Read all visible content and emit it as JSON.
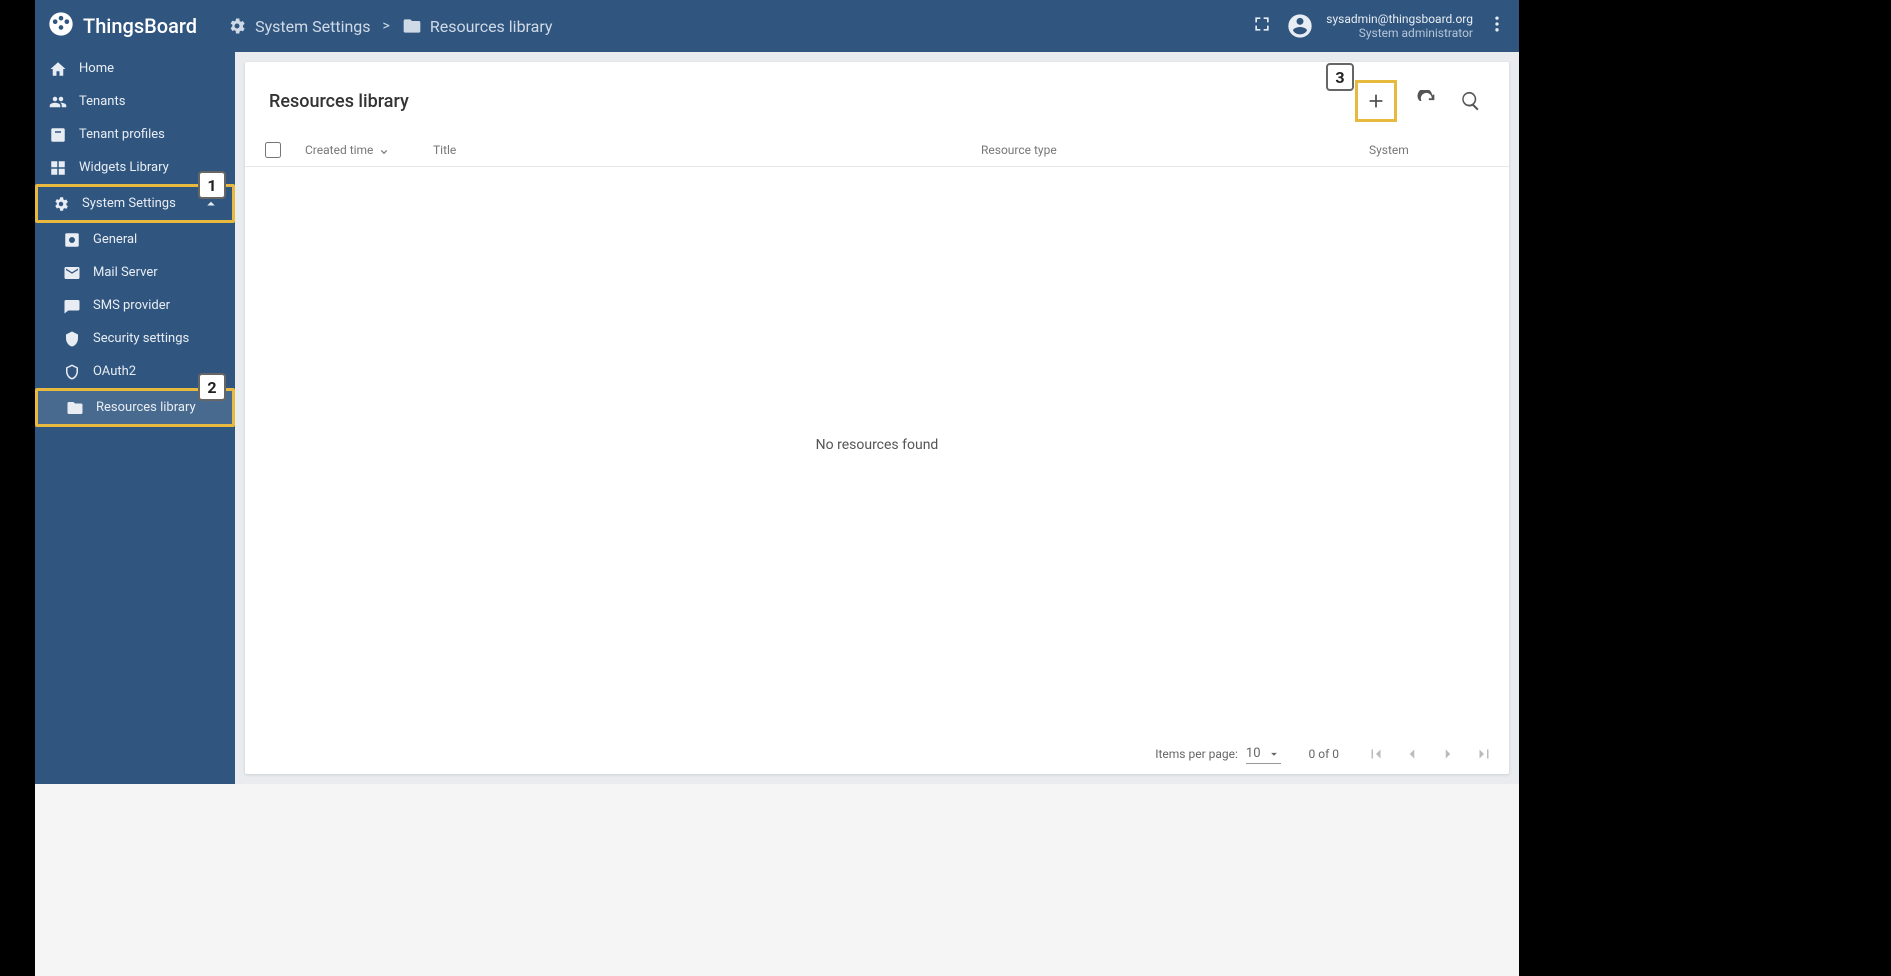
{
  "brand": "ThingsBoard",
  "breadcrumb": {
    "item1": "System Settings",
    "item2": "Resources library"
  },
  "user": {
    "email": "sysadmin@thingsboard.org",
    "role": "System administrator"
  },
  "sidebar": {
    "home": "Home",
    "tenants": "Tenants",
    "tenant_profiles": "Tenant profiles",
    "widgets": "Widgets Library",
    "system_settings": "System Settings",
    "general": "General",
    "mail": "Mail Server",
    "sms": "SMS provider",
    "security": "Security settings",
    "oauth": "OAuth2",
    "resources": "Resources library"
  },
  "page": {
    "title": "Resources library",
    "empty": "No resources found"
  },
  "table": {
    "created": "Created time",
    "title": "Title",
    "type": "Resource type",
    "system": "System"
  },
  "pager": {
    "items_label": "Items per page:",
    "per_page": "10",
    "range": "0 of 0"
  },
  "callouts": {
    "n1": "1",
    "n2": "2",
    "n3": "3"
  }
}
